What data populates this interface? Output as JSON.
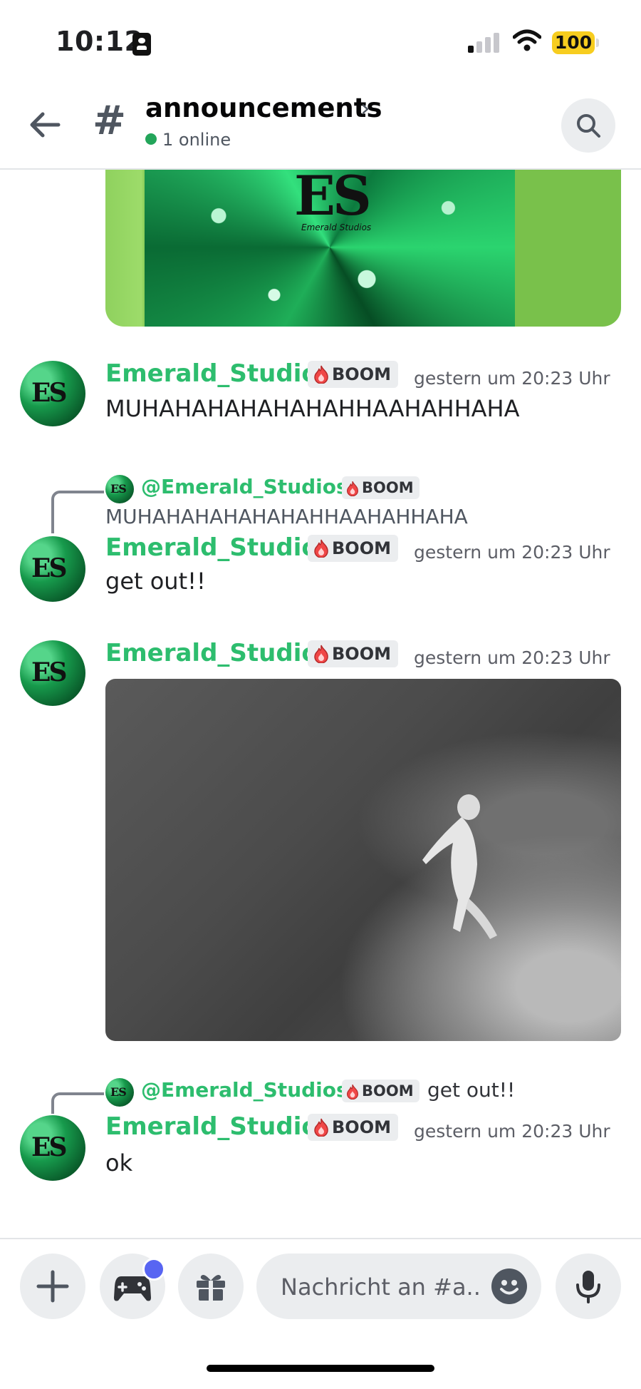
{
  "status_bar": {
    "time": "10:12",
    "battery": "100",
    "battery_color": "#f7cd1f"
  },
  "header": {
    "back_icon": "arrow-left-icon",
    "channel_icon": "hash-icon",
    "channel_name": "announcements",
    "chevron": "›",
    "online_text": "1 online",
    "online_color": "#23a55a",
    "search_icon": "search-icon"
  },
  "banner": {
    "logo_letters": "ES",
    "logo_sub": "Emerald Studios"
  },
  "avatar_letters": "ES",
  "messages": [
    {
      "username": "Emerald_Studios",
      "tag": "BOOM",
      "timestamp": "gestern um 20:23 Uhr",
      "text": "MUHAHAHAHAHAHAHHAAHAHHAHA"
    },
    {
      "reply": {
        "username": "@Emerald_Studios",
        "tag": "BOOM",
        "text": "MUHAHAHAHAHAHAHHAAHAHHAHA"
      },
      "username": "Emerald_Studios",
      "tag": "BOOM",
      "timestamp": "gestern um 20:23 Uhr",
      "text": "get out!!"
    },
    {
      "username": "Emerald_Studios",
      "tag": "BOOM",
      "timestamp": "gestern um 20:23 Uhr",
      "attachment": "video"
    },
    {
      "reply": {
        "username": "@Emerald_Studios",
        "tag": "BOOM",
        "text": "get out!!"
      },
      "username": "Emerald_Studios",
      "tag": "BOOM",
      "timestamp": "gestern um 20:23 Uhr",
      "text": "ok"
    }
  ],
  "composer": {
    "add_icon": "plus-icon",
    "activities_icon": "gamepad-icon",
    "gift_icon": "gift-icon",
    "placeholder": "Nachricht an #a...",
    "emoji_icon": "emoji-icon",
    "mic_icon": "microphone-icon",
    "notification_color": "#5865f2"
  },
  "colors": {
    "username": "#2dbd6e",
    "accent": "#5865f2"
  }
}
